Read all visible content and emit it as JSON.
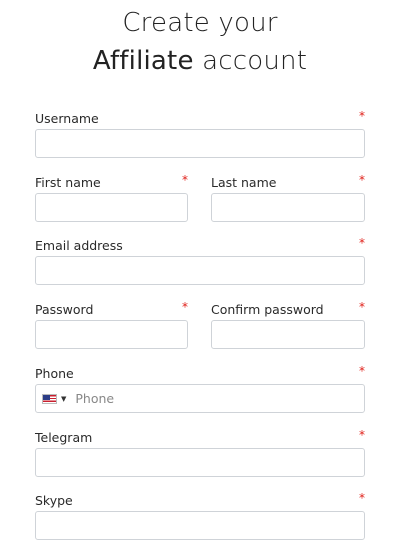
{
  "header": {
    "line1": "Create your",
    "line2_strong": "Affiliate",
    "line2_rest": " account"
  },
  "required_mark": "*",
  "fields": {
    "username": {
      "label": "Username",
      "value": ""
    },
    "first_name": {
      "label": "First name",
      "value": ""
    },
    "last_name": {
      "label": "Last name",
      "value": ""
    },
    "email": {
      "label": "Email address",
      "value": ""
    },
    "password": {
      "label": "Password",
      "value": ""
    },
    "confirm_password": {
      "label": "Confirm password",
      "value": ""
    },
    "phone": {
      "label": "Phone",
      "placeholder": "Phone",
      "country_icon": "us-flag-icon",
      "value": ""
    },
    "telegram": {
      "label": "Telegram",
      "value": ""
    },
    "skype": {
      "label": "Skype",
      "value": ""
    }
  }
}
